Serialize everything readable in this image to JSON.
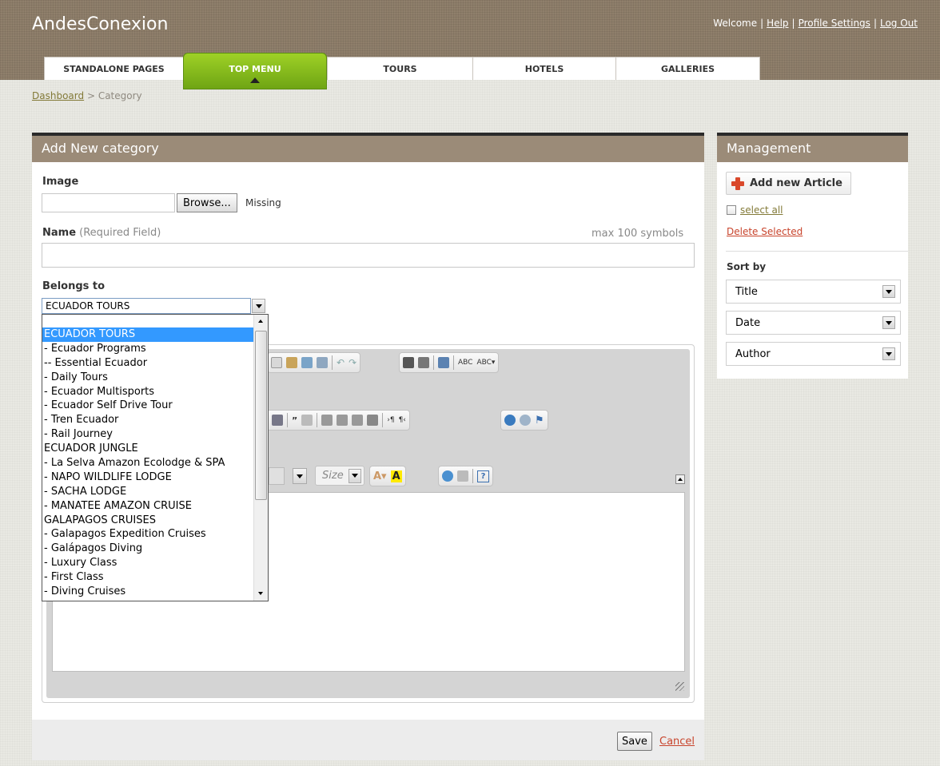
{
  "header": {
    "logo": "AndesConexion",
    "welcome": "Welcome",
    "links": [
      "Help",
      "Profile Settings",
      "Log Out"
    ]
  },
  "tabs": [
    {
      "label": "STANDALONE PAGES",
      "active": false
    },
    {
      "label": "TOP MENU",
      "active": true
    },
    {
      "label": "TOURS",
      "active": false
    },
    {
      "label": "HOTELS",
      "active": false
    },
    {
      "label": "GALLERIES",
      "active": false
    }
  ],
  "breadcrumb": {
    "link": "Dashboard",
    "separator": ">",
    "current": "Category"
  },
  "form": {
    "title": "Add New category",
    "image_label": "Image",
    "file_value": "",
    "browse_label": "Browse...",
    "image_status": "Missing",
    "name_label": "Name",
    "name_hint": "(Required Field)",
    "name_max": "max 100 symbols",
    "name_value": "",
    "belongs_label": "Belongs to",
    "belongs_value": "ECUADOR TOURS",
    "belongs_options": [
      "ECUADOR TOURS",
      "- Ecuador Programs",
      "-- Essential Ecuador",
      "- Daily Tours",
      "- Ecuador Multisports",
      "- Ecuador Self Drive Tour",
      "- Tren Ecuador",
      "- Rail Journey",
      "ECUADOR JUNGLE",
      "- La Selva Amazon Ecolodge & SPA",
      "- NAPO WILDLIFE LODGE",
      "- SACHA LODGE",
      "- MANATEE AMAZON CRUISE",
      "GALAPAGOS CRUISES",
      "- Galapagos Expedition Cruises",
      "- Galápagos Diving",
      "- Luxury Class",
      "- First Class",
      "- Diving Cruises"
    ],
    "editor_size_placeholder": "Size",
    "save_label": "Save",
    "cancel_label": "Cancel"
  },
  "sidebar": {
    "title": "Management",
    "add_label": "Add new Article",
    "select_all": "select all",
    "delete_selected": "Delete Selected",
    "sort_by": "Sort by",
    "sort_options": [
      "Title",
      "Date",
      "Author"
    ]
  },
  "colors": {
    "header": "#8f7f6b",
    "panel_head": "#9b8b78",
    "active_tab": "#7fb61a",
    "link_red": "#c8442c",
    "selection": "#3399ff"
  }
}
